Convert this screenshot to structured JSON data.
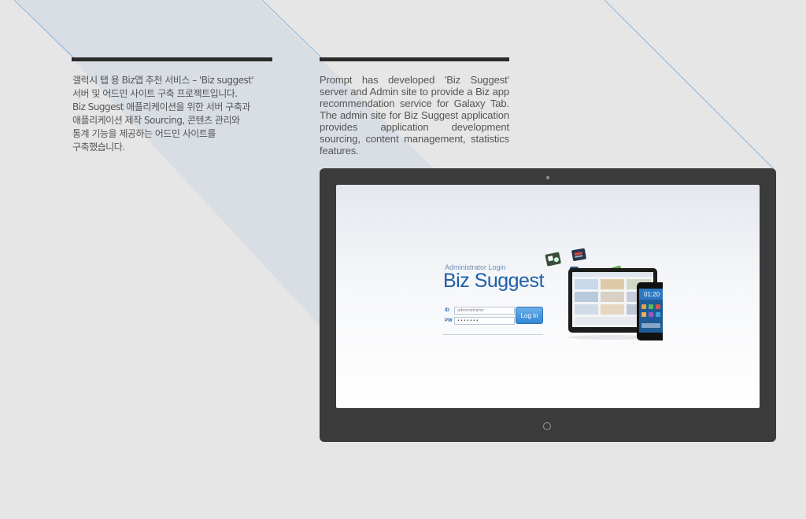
{
  "description_ko": [
    "갤럭시 탭 용 Biz앱 추천 서비스 – 'Biz suggest'",
    "서버 및 어드민 사이트 구축 프로젝트입니다.",
    "Biz Suggest 애플리케이션을 위한 서버 구축과",
    "애플리케이션 제작 Sourcing, 콘텐츠 관리와",
    "통계 기능을 제공하는 어드민 사이트를",
    "구축했습니다."
  ],
  "description_en": "Prompt has developed 'Biz Suggest' server and Admin site to provide a Biz app recommendation service for Galaxy Tab. The admin site for Biz Suggest application provides application development sourcing, content management, statistics features.",
  "login": {
    "caption": "Administrator Login",
    "title": "Biz Suggest",
    "id_label": "ID",
    "pw_label": "PW",
    "id_value": "administrator",
    "pw_value": "•••••••",
    "button_label": "Log in"
  },
  "phone_clock": "01:20",
  "colors": {
    "background": "#e6e6e6",
    "rule": "#2b2b2b",
    "tablet_bezel": "#3b3b3b",
    "brand_blue": "#1e5fa8",
    "accent_line": "#7aaee0"
  }
}
